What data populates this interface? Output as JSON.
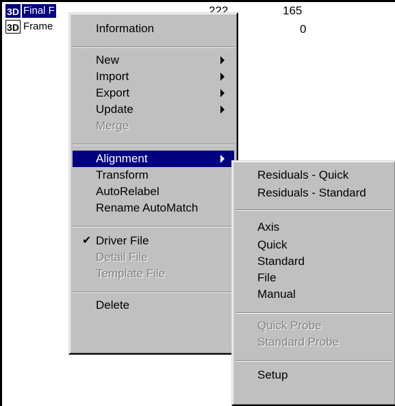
{
  "rows": [
    {
      "badge": "3D",
      "name": "Final F",
      "value1": "222",
      "value2": "165",
      "selected": true
    },
    {
      "badge": "3D",
      "name": "Frame",
      "value1": "",
      "value2": "0",
      "selected": false
    }
  ],
  "context_menu": {
    "items": {
      "information": "Information",
      "new": "New",
      "import": "Import",
      "export": "Export",
      "update": "Update",
      "merge": "Merge",
      "alignment": "Alignment",
      "transform": "Transform",
      "autorelabel": "AutoRelabel",
      "rename_automatch": "Rename AutoMatch",
      "driver_file": "Driver File",
      "detail_file": "Detail File",
      "template_file": "Template File",
      "delete": "Delete"
    },
    "check_glyph": "✔"
  },
  "alignment_submenu": {
    "items": {
      "residuals_quick": "Residuals - Quick",
      "residuals_standard": "Residuals - Standard",
      "axis": "Axis",
      "quick": "Quick",
      "standard": "Standard",
      "file": "File",
      "manual": "Manual",
      "quick_probe": "Quick Probe",
      "standard_probe": "Standard Probe",
      "setup": "Setup"
    }
  },
  "colors": {
    "menu_bg": "#c0c0c0",
    "highlight": "#000080",
    "disabled": "#808080"
  }
}
